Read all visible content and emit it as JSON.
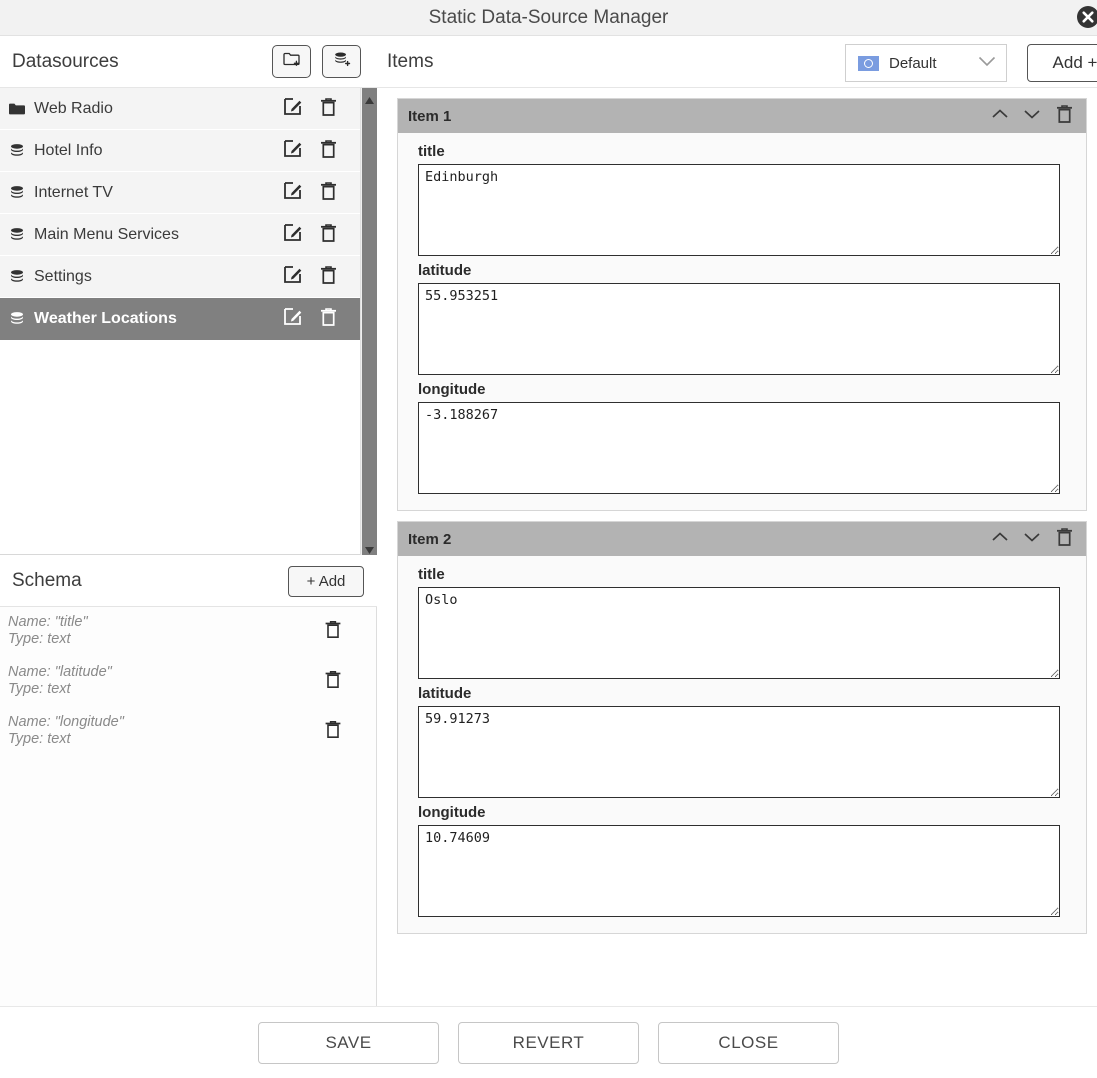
{
  "window": {
    "title": "Static Data-Source Manager",
    "close_icon": "close-circle-icon"
  },
  "sidebar": {
    "header": {
      "label": "Datasources",
      "add_folder_icon": "folder-plus-icon",
      "add_datasource_icon": "database-plus-icon"
    },
    "items": [
      {
        "label": "Web Radio",
        "icon": "folder-icon",
        "selected": false,
        "edit_icon": "edit-icon",
        "delete_icon": "trash-icon"
      },
      {
        "label": "Hotel Info",
        "icon": "database-icon",
        "selected": false,
        "edit_icon": "edit-icon",
        "delete_icon": "trash-icon"
      },
      {
        "label": "Internet TV",
        "icon": "database-icon",
        "selected": false,
        "edit_icon": "edit-icon",
        "delete_icon": "trash-icon"
      },
      {
        "label": "Main Menu Services",
        "icon": "database-icon",
        "selected": false,
        "edit_icon": "edit-icon",
        "delete_icon": "trash-icon"
      },
      {
        "label": "Settings",
        "icon": "database-icon",
        "selected": false,
        "edit_icon": "edit-icon",
        "delete_icon": "trash-icon"
      },
      {
        "label": "Weather Locations",
        "icon": "database-icon",
        "selected": true,
        "edit_icon": "edit-icon",
        "delete_icon": "trash-icon"
      }
    ],
    "scrollbar": {
      "up_arrow_icon": "caret-up-icon",
      "down_arrow_icon": "caret-down-icon"
    }
  },
  "schema": {
    "header": {
      "label": "Schema",
      "add_label": "+ Add"
    },
    "rows": [
      {
        "name_line": "Name: \"title\"",
        "type_line": "Type: text",
        "delete_icon": "trash-icon"
      },
      {
        "name_line": "Name: \"latitude\"",
        "type_line": "Type: text",
        "delete_icon": "trash-icon"
      },
      {
        "name_line": "Name: \"longitude\"",
        "type_line": "Type: text",
        "delete_icon": "trash-icon"
      }
    ]
  },
  "items_panel": {
    "header": {
      "label": "Items",
      "language_select": {
        "value": "Default",
        "flag_icon": "un-flag-icon",
        "chevron_icon": "chevron-down-icon"
      },
      "add_label": "Add +"
    },
    "items": [
      {
        "title": "Item 1",
        "move_up_icon": "chevron-up-icon",
        "move_down_icon": "chevron-down-icon",
        "delete_icon": "trash-icon",
        "fields": [
          {
            "label": "title",
            "value": "Edinburgh"
          },
          {
            "label": "latitude",
            "value": "55.953251"
          },
          {
            "label": "longitude",
            "value": "-3.188267"
          }
        ]
      },
      {
        "title": "Item 2",
        "move_up_icon": "chevron-up-icon",
        "move_down_icon": "chevron-down-icon",
        "delete_icon": "trash-icon",
        "fields": [
          {
            "label": "title",
            "value": "Oslo"
          },
          {
            "label": "latitude",
            "value": "59.91273"
          },
          {
            "label": "longitude",
            "value": "10.74609"
          }
        ]
      }
    ]
  },
  "footer": {
    "buttons": [
      {
        "label": "SAVE"
      },
      {
        "label": "REVERT"
      },
      {
        "label": "CLOSE"
      }
    ]
  },
  "colors": {
    "titlebar_bg": "#f2f2f2",
    "selected_row_bg": "#808080",
    "item_header_bg": "#b3b3b3",
    "list_row_bg": "#f4f4f4",
    "flag_blue": "#7a9ce0"
  }
}
